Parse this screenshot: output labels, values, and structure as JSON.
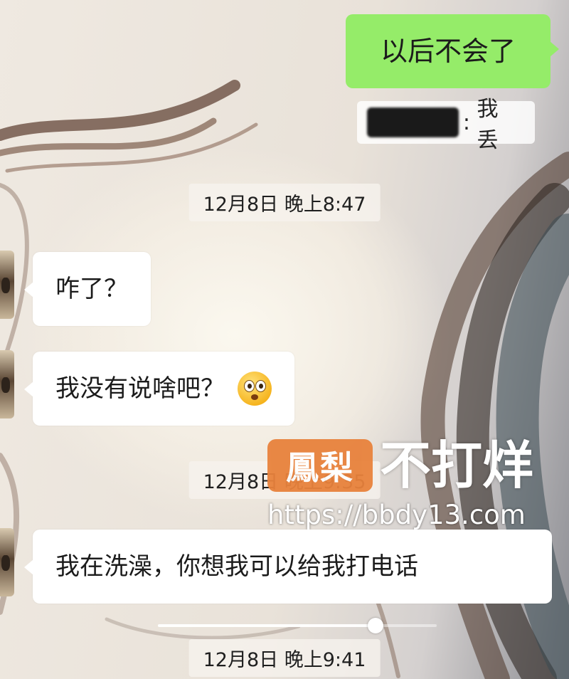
{
  "chat": {
    "messages": [
      {
        "side": "out",
        "text": "以后不会了"
      },
      {
        "side": "quote",
        "text": "我丢"
      },
      {
        "side": "time",
        "text": "12月8日 晚上8:47"
      },
      {
        "side": "in",
        "text": "咋了？"
      },
      {
        "side": "in",
        "text": "我没有说啥吧？",
        "emoji": "astonished-face-emoji"
      },
      {
        "side": "time",
        "text": "12月8日 晚上9:35"
      },
      {
        "side": "in",
        "text": "我在洗澡，你想我可以给我打电话"
      },
      {
        "side": "time",
        "text": "12月8日 晚上9:41"
      }
    ]
  },
  "watermark": {
    "badge": "鳳梨",
    "title": "不打烊",
    "url": "https://bbdy13.com"
  },
  "video_progress": 0.78,
  "colors": {
    "outgoing_bubble": "#95ec69",
    "incoming_bubble": "#ffffff",
    "watermark_badge": "#e8823c"
  }
}
